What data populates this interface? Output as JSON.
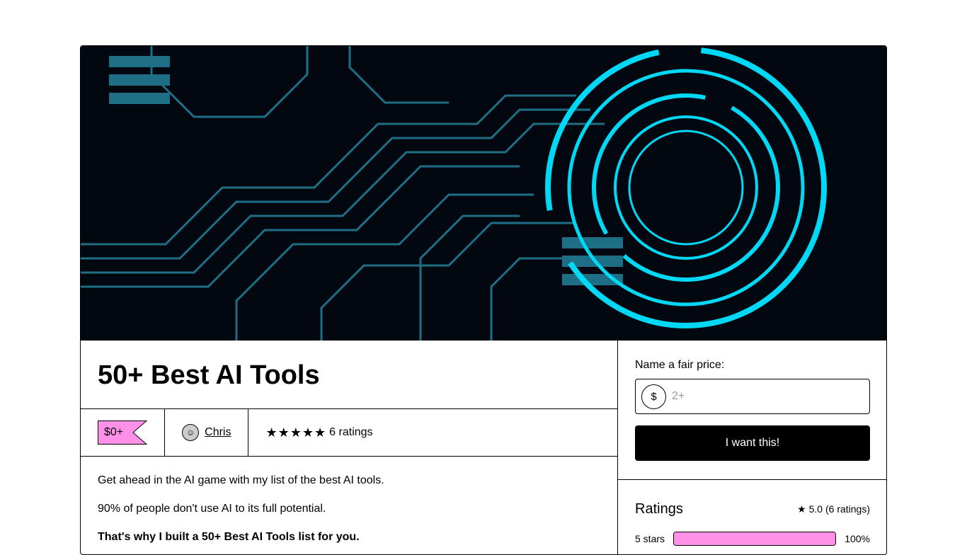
{
  "product": {
    "title": "50+ Best AI Tools",
    "price": "$0+",
    "creator": "Chris",
    "rating_count_label": "6 ratings",
    "stars": "★★★★★"
  },
  "description": [
    "Get ahead in the AI game with my list of the best AI tools.",
    "90% of people don't use AI to its full potential.",
    "That's why I built a 50+ Best AI Tools list for you."
  ],
  "purchase": {
    "label": "Name a fair price:",
    "currency": "$",
    "placeholder": "2+",
    "button": "I want this!"
  },
  "ratings": {
    "title": "Ratings",
    "summary": "5.0 (6 ratings)",
    "rows": [
      {
        "label": "5 stars",
        "percent": "100%",
        "fraction": 1.0
      }
    ]
  },
  "colors": {
    "accent": "#ff90e8",
    "hero_bg": "#03070f",
    "circuit": "#1e6f86",
    "ring": "#00d8f5"
  }
}
